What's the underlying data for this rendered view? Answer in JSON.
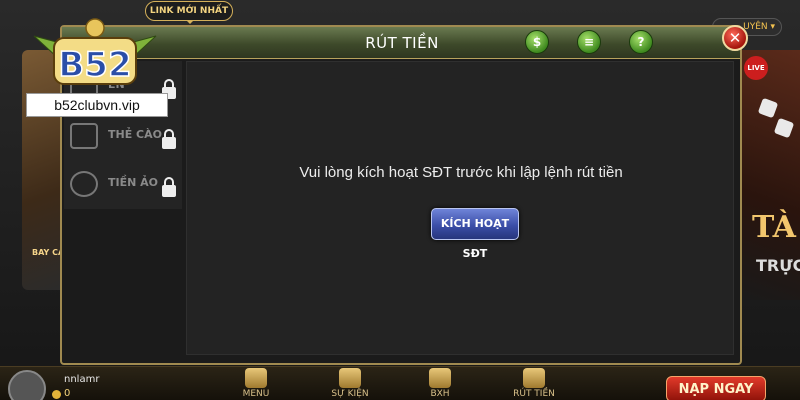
{
  "modal": {
    "title": "RÚT TIỀN",
    "header_icons": [
      "dollar-icon",
      "document-icon",
      "help-icon"
    ],
    "message": "Vui lòng kích hoạt SĐT trước khi lập lệnh rút tiền",
    "activate_button": "KÍCH HOẠT SĐT",
    "close_label": "✕"
  },
  "sidebar": {
    "items": [
      {
        "label": "EN",
        "icon": "bank-icon",
        "locked": true
      },
      {
        "label": "THẺ CÀO",
        "icon": "card-icon",
        "locked": true
      },
      {
        "label": "TIỀN ẢO",
        "icon": "bitcoin-icon",
        "locked": true
      }
    ]
  },
  "branding": {
    "logo_text": "B52",
    "site_url": "b52clubvn.vip",
    "link_badge": "LINK MỚI NHẤT"
  },
  "background": {
    "left_banner_text": "BAY CAO",
    "right_banner_title": "TÀ",
    "right_banner_sub": "TRỰC",
    "live_badge": "LIVE",
    "language": "UYÊN ▾"
  },
  "bottom_bar": {
    "username": "nnlamr",
    "balance": "0",
    "nav": [
      {
        "label": "MENU"
      },
      {
        "label": "SỰ KIỆN"
      },
      {
        "label": "BXH"
      },
      {
        "label": "RÚT TIỀN"
      }
    ],
    "topup_button": "NẠP NGAY"
  },
  "colors": {
    "header_green": "#3e4a2a",
    "activate_blue": "#3b4ea8",
    "close_red": "#a4150c",
    "gold": "#d4b05a"
  }
}
